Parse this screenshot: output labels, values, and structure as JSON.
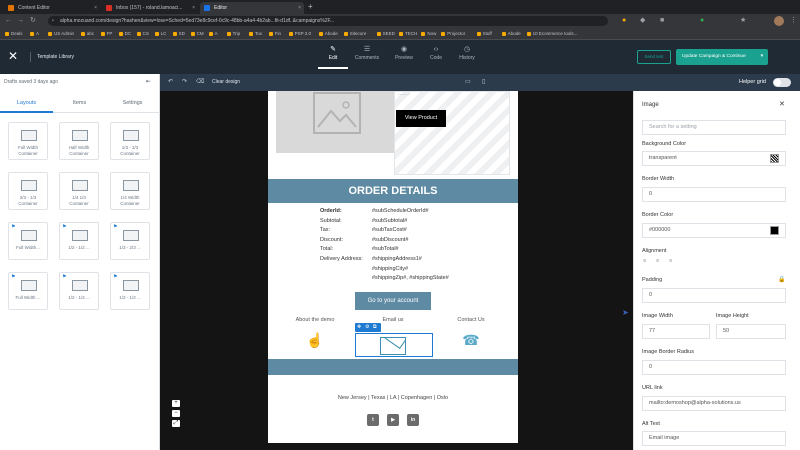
{
  "browser": {
    "tabs": [
      {
        "title": "Content Editor",
        "favicon": "#e37400",
        "active": false
      },
      {
        "title": "Inbox (157) - roland.lamoaci...",
        "favicon": "#d93025",
        "active": false
      },
      {
        "title": "Editor",
        "favicon": "#1a73e8",
        "active": true
      }
    ],
    "new_tab": "+",
    "url": "alpha.mozuand.com/design?hashen&view=lose=Sched=5ed73e8c9cef-0c9c-48bb-a4a4-4b2ab...fit-d1df..&campaigns%2F...",
    "bookmarks": [
      "Deals",
      "A",
      "US Admin",
      "abc",
      "FP",
      "DC",
      "CS",
      "LC",
      "SD",
      "CM",
      "A",
      "Trip",
      "Tox",
      "Fin",
      "PSP 2.0",
      "Abode",
      "Sitecore",
      "SEED",
      "TECH",
      "Now",
      "Projector",
      "Stuff",
      "Abode",
      "10 Ecommerce tools..."
    ]
  },
  "appbar": {
    "close_glyph": "✕",
    "template_library": "Template Library",
    "tabs": [
      {
        "label": "Edit",
        "icon": "✎",
        "active": true
      },
      {
        "label": "Comments",
        "icon": "☰",
        "active": false
      },
      {
        "label": "Preview",
        "icon": "◉",
        "active": false
      },
      {
        "label": "Code",
        "icon": "‹›",
        "active": false
      },
      {
        "label": "History",
        "icon": "◷",
        "active": false
      }
    ],
    "send_test": "Send test",
    "update_button": "Update Campaign & Continue",
    "update_caret": "▾"
  },
  "left_panel": {
    "saved_text": "Drafts saved 3 days ago",
    "collapse_glyph": "⇤",
    "tabs": [
      "Layouts",
      "Items",
      "Settings"
    ],
    "cards": [
      {
        "label": "Full Width Container",
        "pinned": false
      },
      {
        "label": "Half Width Container",
        "pinned": false
      },
      {
        "label": "1/3 - 2/3 Container",
        "pinned": false
      },
      {
        "label": "2/3 - 1/3 Container",
        "pinned": false
      },
      {
        "label": "1/4 1/3 Container",
        "pinned": false
      },
      {
        "label": "1/4 Width Container",
        "pinned": false
      },
      {
        "label": "Full Width...",
        "pinned": true
      },
      {
        "label": "1/2 - 1/2 ...",
        "pinned": true
      },
      {
        "label": "1/3 - 2/3 ...",
        "pinned": true
      },
      {
        "label": "Full Width ...",
        "pinned": true
      },
      {
        "label": "1/2 - 1/2 ...",
        "pinned": true
      },
      {
        "label": "1/2 - 1/2 ...",
        "pinned": true
      }
    ]
  },
  "canvas_toolbar": {
    "undo": "↶",
    "redo": "↷",
    "clear_design": "Clear design",
    "desktop_icon": "▭",
    "mobile_icon": "▯"
  },
  "zoom": [
    "+",
    "−",
    "⤢"
  ],
  "email": {
    "partial_text": "........",
    "view_product": "View Product",
    "order_header": "ORDER DETAILS",
    "order_rows": [
      {
        "key": "OrderId:",
        "value": "#subScheduleOrderId#",
        "bold": true
      },
      {
        "key": "Subtotal:",
        "value": "#subSubtotal#",
        "bold": false
      },
      {
        "key": "Tax:",
        "value": "#subTaxCost#",
        "bold": false
      },
      {
        "key": "Discount:",
        "value": "#subDiscount#",
        "bold": false
      },
      {
        "key": "Total:",
        "value": "#subTotal#",
        "bold": false
      },
      {
        "key": "Delivery Address:",
        "value": "#shippingAddress1#",
        "bold": false
      },
      {
        "key": "",
        "value": "#shippingCity#",
        "bold": false
      },
      {
        "key": "",
        "value": "#shippingZip#, #shippingState#",
        "bold": false
      }
    ],
    "goto_button": "Go to your account",
    "icon_columns": [
      {
        "label": "About the demo",
        "glyph": "☝"
      },
      {
        "label": "Email us",
        "glyph": "✉"
      },
      {
        "label": "Contact Us",
        "glyph": "☎"
      }
    ],
    "selection_tools": [
      "✥",
      "⚙",
      "⧉"
    ],
    "locations": "New Jersey | Texas | LA | Copenhagen | Oslo",
    "social": [
      "t",
      "▶",
      "in"
    ]
  },
  "right_panel": {
    "helper_grid": "Helper grid",
    "title": "Image",
    "close_glyph": "✕",
    "search_placeholder": "Search for a setting",
    "background_color_label": "Background Color",
    "background_color_value": "transparent",
    "border_width_label": "Border Width",
    "border_width_value": "0",
    "border_color_label": "Border Color",
    "border_color_value": "#000000",
    "border_color_swatch": "#000000",
    "alignment_label": "Alignment",
    "alignment_icons": [
      "≡",
      "≡",
      "≡"
    ],
    "padding_label": "Padding",
    "padding_lock": "🔒",
    "padding_value": "0",
    "image_width_label": "Image Width",
    "image_width_value": "77",
    "image_height_label": "Image Height",
    "image_height_value": "50",
    "border_radius_label": "Image Border Radius",
    "border_radius_value": "0",
    "url_link_label": "URL link",
    "url_link_value": "mailto:demoshop@alpha-solutions.us",
    "alt_text_label": "Alt Text",
    "alt_text_value": "Email image"
  },
  "colors": {
    "accent": "#1aa18f",
    "email_band": "#5f8aa3",
    "selection": "#1f7ad1"
  }
}
